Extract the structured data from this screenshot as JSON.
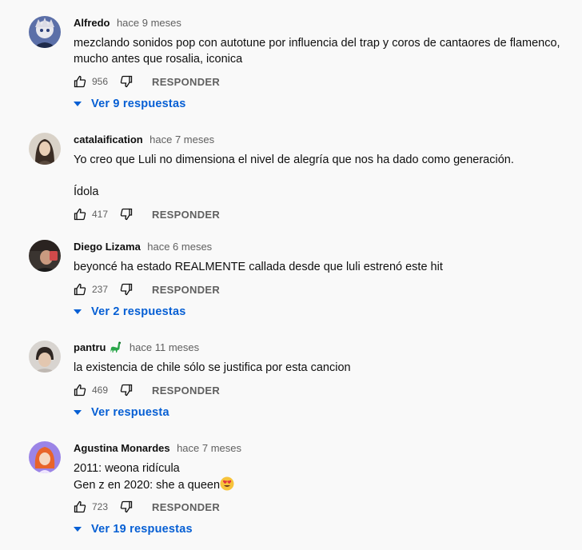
{
  "comments": [
    {
      "author": "Alfredo",
      "time": "hace 9 meses",
      "text": "mezclando sonidos pop con autotune por influencia del trap y coros  de cantaores de flamenco, mucho antes que rosalia, iconica",
      "likes": "956",
      "reply_label": "RESPONDER",
      "replies_label": "Ver 9 respuestas",
      "avatar": "anime-character-avatar"
    },
    {
      "author": "catalaification",
      "time": "hace 7 meses",
      "text": "Yo creo que Luli no dimensiona el nivel de alegría que nos ha dado como generación.\n\nÍdola",
      "likes": "417",
      "reply_label": "RESPONDER",
      "avatar": "portrait-avatar"
    },
    {
      "author": "Diego Lizama",
      "time": "hace 6 meses",
      "text": "beyoncé ha estado REALMENTE callada desde que luli estrenó este hit",
      "likes": "237",
      "reply_label": "RESPONDER",
      "replies_label": "Ver 2 respuestas",
      "avatar": "photo-avatar"
    },
    {
      "author": "pantru",
      "author_emoji": "dinosaur-emoji",
      "time": "hace 11 meses",
      "text": "la existencia de chile sólo se justifica por esta cancion",
      "likes": "469",
      "reply_label": "RESPONDER",
      "replies_label": "Ver respuesta",
      "avatar": "photo-avatar"
    },
    {
      "author": "Agustina Monardes",
      "time": "hace 7 meses",
      "text_line1": "2011: weona ridícula",
      "text_line2": "Gen z en 2020: she a queen",
      "text_emoji": "heart-eyes-emoji",
      "likes": "723",
      "reply_label": "RESPONDER",
      "replies_label": "Ver 19 respuestas",
      "avatar": "cartoon-avatar"
    }
  ],
  "colors": {
    "background": "#f9f9f9",
    "text": "#0f0f0f",
    "secondary": "#606060",
    "link": "#065fd4"
  }
}
